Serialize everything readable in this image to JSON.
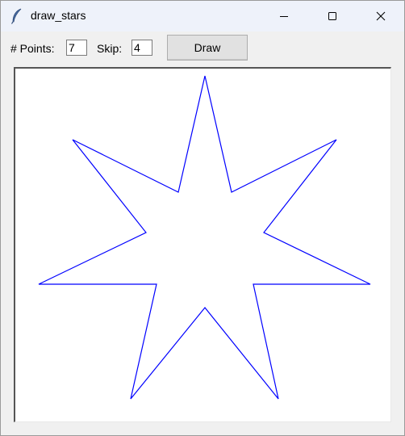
{
  "window": {
    "title": "draw_stars",
    "icon": "feather-icon",
    "controls": {
      "minimize": "minimize-icon",
      "maximize": "maximize-icon",
      "close": "close-icon"
    }
  },
  "toolbar": {
    "points_label": "# Points:",
    "points_value": "7",
    "skip_label": "Skip:",
    "skip_value": "4",
    "draw_label": "Draw"
  },
  "canvas": {
    "background": "#ffffff",
    "star": {
      "points": 7,
      "skip": 4,
      "stroke_color": "#0000ff"
    }
  }
}
